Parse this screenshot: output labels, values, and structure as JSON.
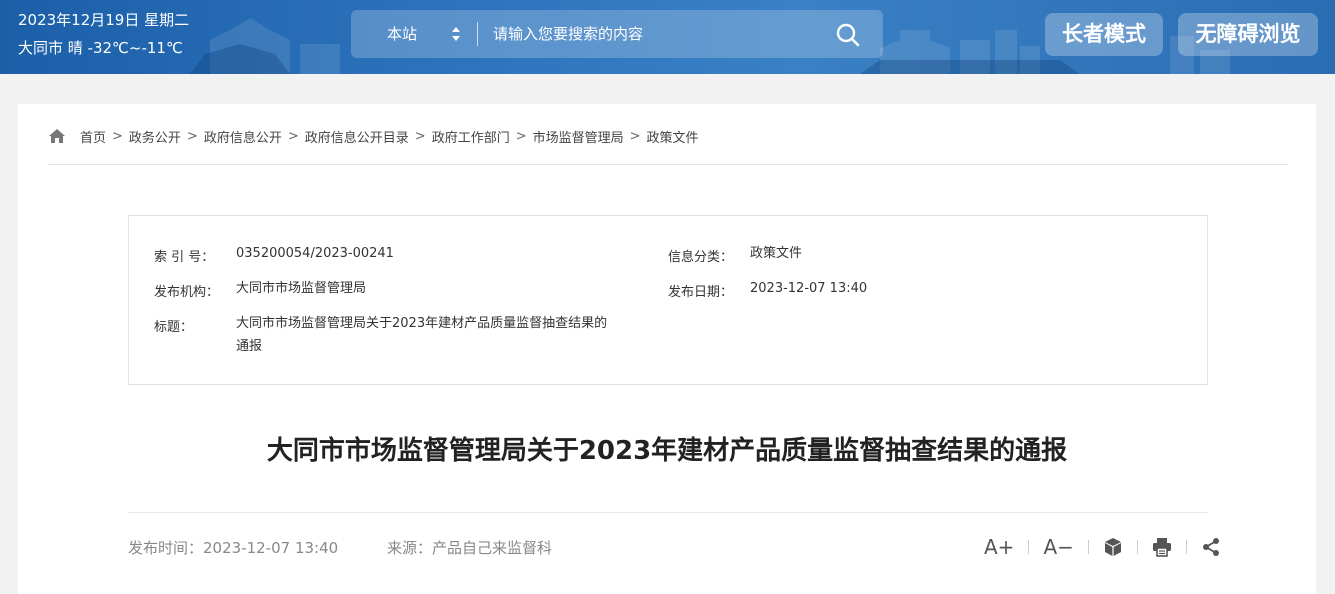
{
  "header": {
    "date": "2023年12月19日 星期二",
    "weather": "大同市 晴 -32℃~-11℃",
    "search": {
      "scope": "本站",
      "placeholder": "请输入您要搜索的内容"
    },
    "elder_mode": "长者模式",
    "accessible": "无障碍浏览"
  },
  "breadcrumb": [
    "首页",
    "政务公开",
    "政府信息公开",
    "政府信息公开目录",
    "政府工作部门",
    "市场监督管理局",
    "政策文件"
  ],
  "breadcrumb_sep": ">",
  "meta": {
    "index_label": "索 引 号：",
    "index_value": "035200054/2023-00241",
    "category_label": "信息分类：",
    "category_value": "政策文件",
    "org_label": "发布机构：",
    "org_value": "大同市市场监督管理局",
    "date_label": "发布日期：",
    "date_value": "2023-12-07 13:40",
    "title_label": "标题：",
    "title_value_line1": "大同市市场监督管理局关于2023年建材产品质量监督抽查结果的",
    "title_value_line2": "通报"
  },
  "article": {
    "title": "大同市市场监督管理局关于2023年建材产品质量监督抽查结果的通报",
    "publish_time": "发布时间：2023-12-07 13:40",
    "source": "来源：产品自己来监督科"
  },
  "tools": {
    "font_up": "A+",
    "font_down": "A−"
  },
  "icons": [
    "home-icon",
    "search-icon",
    "sort-arrows-icon",
    "cube-icon",
    "print-icon",
    "share-icon"
  ]
}
